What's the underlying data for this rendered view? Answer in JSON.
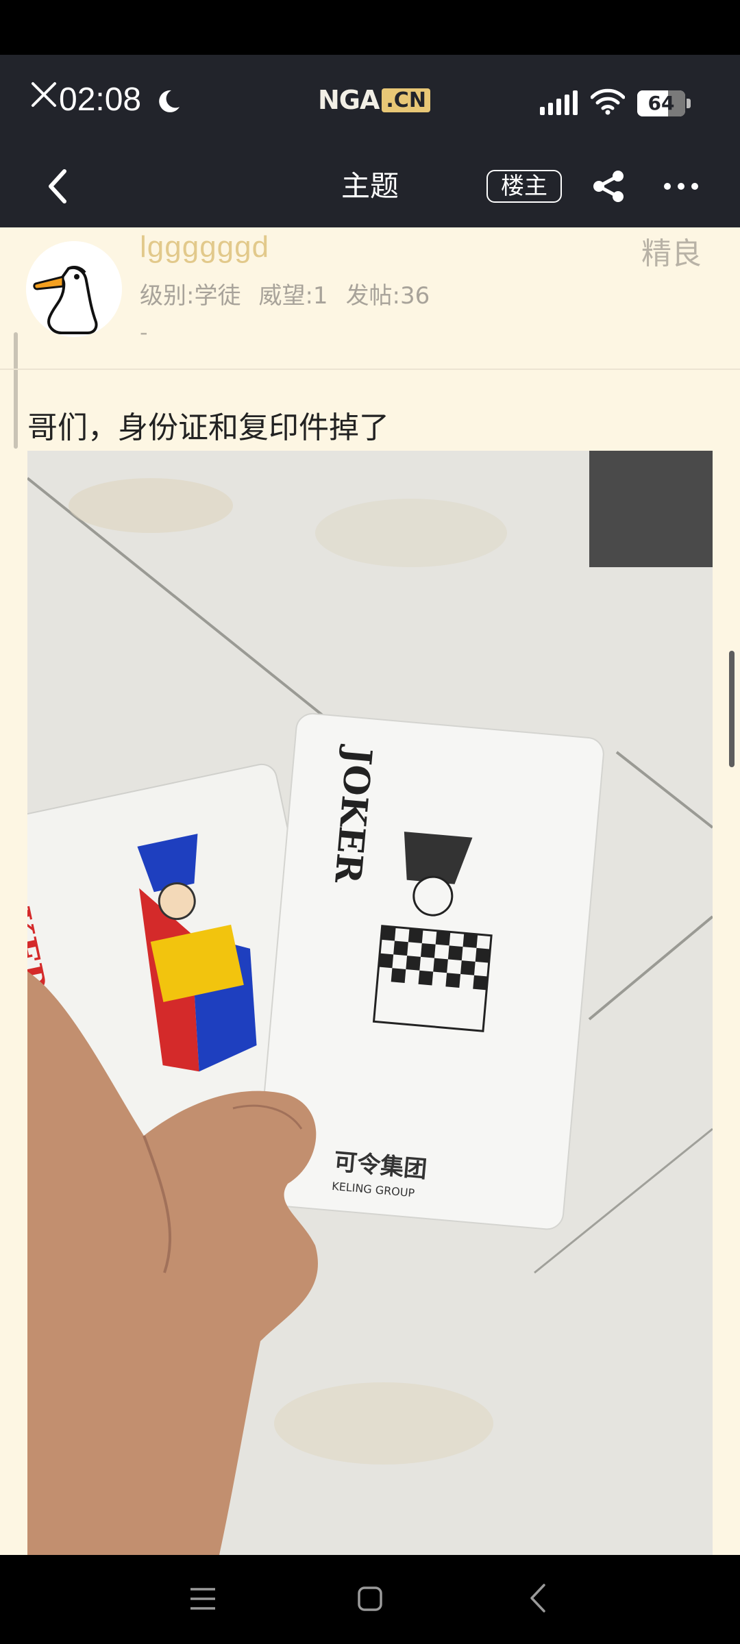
{
  "status_bar": {
    "time": "02:08",
    "battery_level": "64",
    "battery_fraction": 0.64,
    "logo_main": "NGA",
    "logo_suffix": ".CN"
  },
  "nav": {
    "title": "主题",
    "louzhu_label": "楼主"
  },
  "post": {
    "author": "lggggggd",
    "level": "级别:学徒",
    "prestige": "威望:1",
    "posts": "发帖:36",
    "signature": "-",
    "badge": "精良",
    "content": "哥们，身份证和复印件掉了"
  },
  "photo": {
    "card_left_text": "JOKER",
    "card_right_text": "JOKER",
    "card_right_brand_cn": "可令集团",
    "card_right_brand_en": "KELING GROUP"
  },
  "colors": {
    "background": "#fdf6e3",
    "header": "#22242b",
    "username": "#e2c98b",
    "stats": "#a8a39a"
  },
  "icons": {
    "close": "close-icon",
    "moon": "moon-icon",
    "signal": "signal-icon",
    "wifi": "wifi-icon",
    "back": "chevron-left-icon",
    "share": "share-icon",
    "more": "more-dots-icon"
  }
}
